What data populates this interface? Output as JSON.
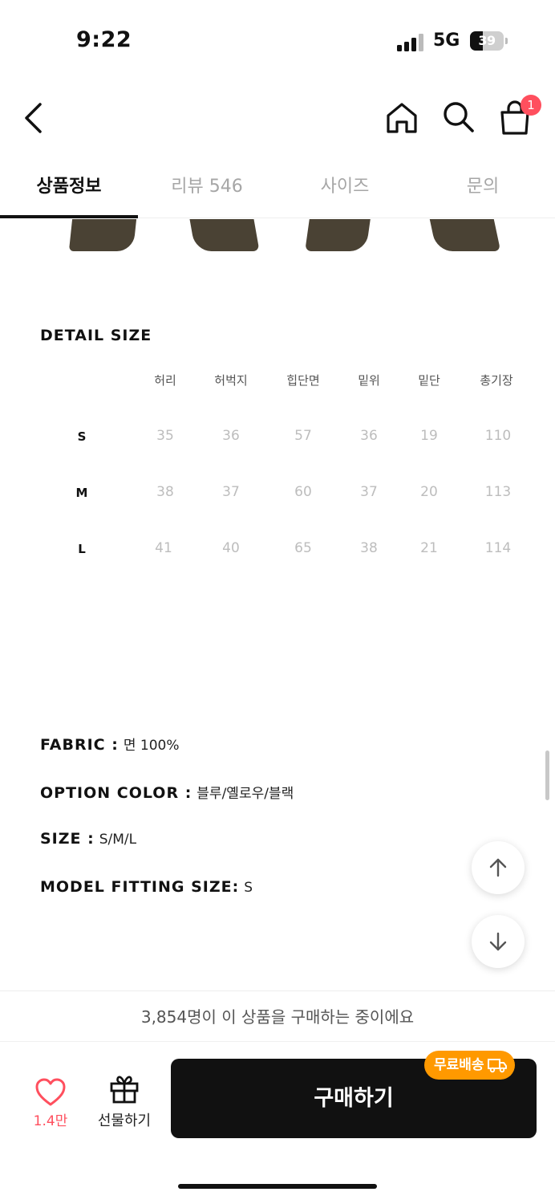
{
  "status_bar": {
    "time": "9:22",
    "network": "5G",
    "battery": "39",
    "battery_level": 0.39
  },
  "header": {
    "back_icon": "chevron-left-icon",
    "home_icon": "home-icon",
    "search_icon": "search-icon",
    "cart_icon": "shopping-bag-icon",
    "cart_badge": "1"
  },
  "tabs": [
    {
      "label": "상품정보",
      "active": true
    },
    {
      "label": "리뷰 546",
      "active": false
    },
    {
      "label": "사이즈",
      "active": false
    },
    {
      "label": "문의",
      "active": false
    }
  ],
  "detail_size": {
    "title": "DETAIL SIZE",
    "columns": [
      "허리",
      "허벅지",
      "힙단면",
      "밑위",
      "밑단",
      "총기장"
    ],
    "rows": [
      {
        "size": "S",
        "values": [
          "35",
          "36",
          "57",
          "36",
          "19",
          "110"
        ]
      },
      {
        "size": "M",
        "values": [
          "38",
          "37",
          "60",
          "37",
          "20",
          "113"
        ]
      },
      {
        "size": "L",
        "values": [
          "41",
          "40",
          "65",
          "38",
          "21",
          "114"
        ]
      }
    ]
  },
  "specs": [
    {
      "key": "FABRIC :",
      "value": "면 100%"
    },
    {
      "key": "OPTION COLOR :",
      "value": "블루/옐로우/블랙"
    },
    {
      "key": "SIZE :",
      "value": "S/M/L"
    },
    {
      "key": "MODEL FITTING SIZE:",
      "value": "S"
    }
  ],
  "purchase_notice": "3,854명이 이 상품을 구매하는 중이에요",
  "bottom_bar": {
    "like_count": "1.4만",
    "gift_label": "선물하기",
    "buy_label": "구매하기",
    "free_shipping": "무료배송"
  },
  "colors": {
    "accent_red": "#ff4f5e",
    "shipping_orange": "#ff9900",
    "buy_button": "#111111"
  }
}
